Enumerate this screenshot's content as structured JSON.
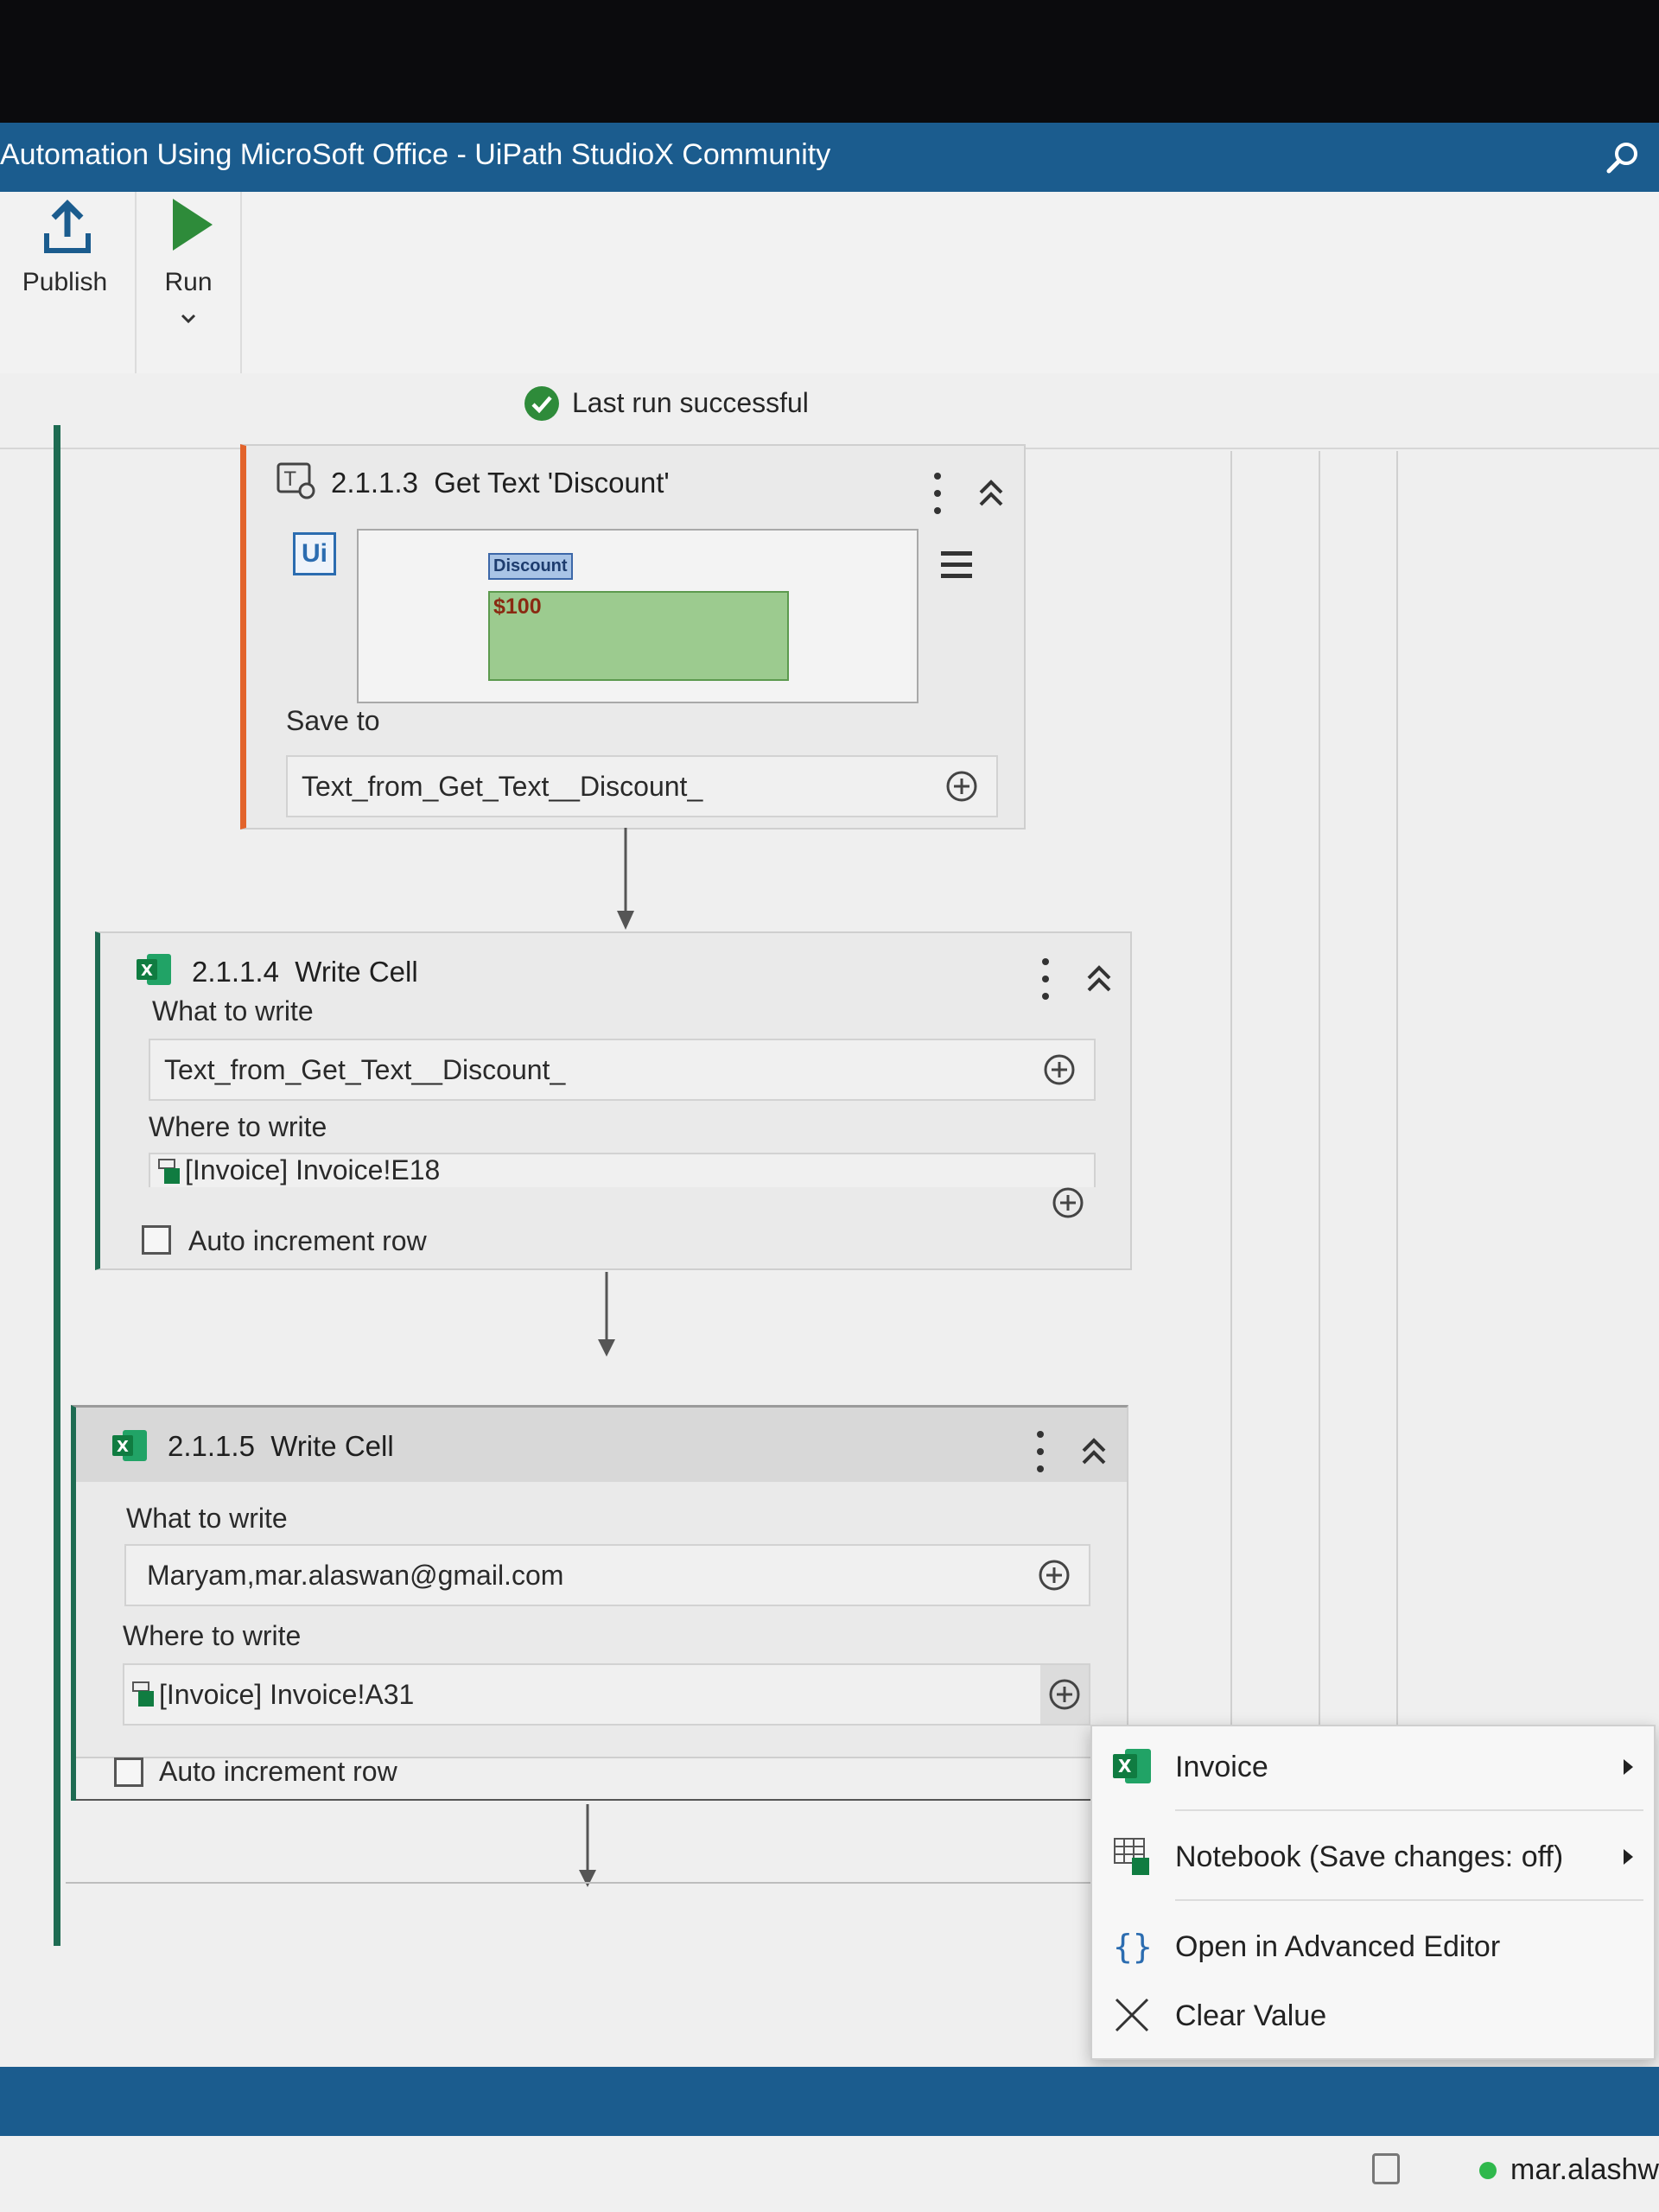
{
  "window": {
    "title": "Automation Using MicroSoft Office - UiPath StudioX Community"
  },
  "toolbar": {
    "publish_label": "Publish",
    "run_label": "Run"
  },
  "status": {
    "text": "Last run successful",
    "color": "#2e8b3a"
  },
  "activities": [
    {
      "number": "2.1.1.3",
      "title": "Get Text 'Discount'",
      "preview_tag": "Discount",
      "preview_value": "$100",
      "save_to_label": "Save to",
      "save_to_value": "Text_from_Get_Text__Discount_",
      "accent": "#e2632b"
    },
    {
      "number": "2.1.1.4",
      "title": "Write Cell",
      "what_label": "What to write",
      "what_value": "Text_from_Get_Text__Discount_",
      "where_label": "Where to write",
      "where_value": "[Invoice] Invoice!E18",
      "auto_increment_label": "Auto increment row",
      "accent": "#1e6b52"
    },
    {
      "number": "2.1.1.5",
      "title": "Write Cell",
      "what_label": "What to write",
      "what_value": "Maryam,mar.alaswan@gmail.com",
      "where_label": "Where to write",
      "where_value": "[Invoice] Invoice!A31",
      "auto_increment_label": "Auto increment row",
      "accent": "#1e6b52"
    }
  ],
  "context_menu": {
    "items": [
      {
        "label": "Invoice",
        "icon": "excel-icon"
      },
      {
        "label": "Notebook (Save changes: off)",
        "icon": "notebook-icon"
      },
      {
        "label": "Open in Advanced Editor",
        "icon": "braces-icon"
      },
      {
        "label": "Clear Value",
        "icon": "close-icon"
      }
    ]
  },
  "footer": {
    "user": "mar.alashw"
  }
}
